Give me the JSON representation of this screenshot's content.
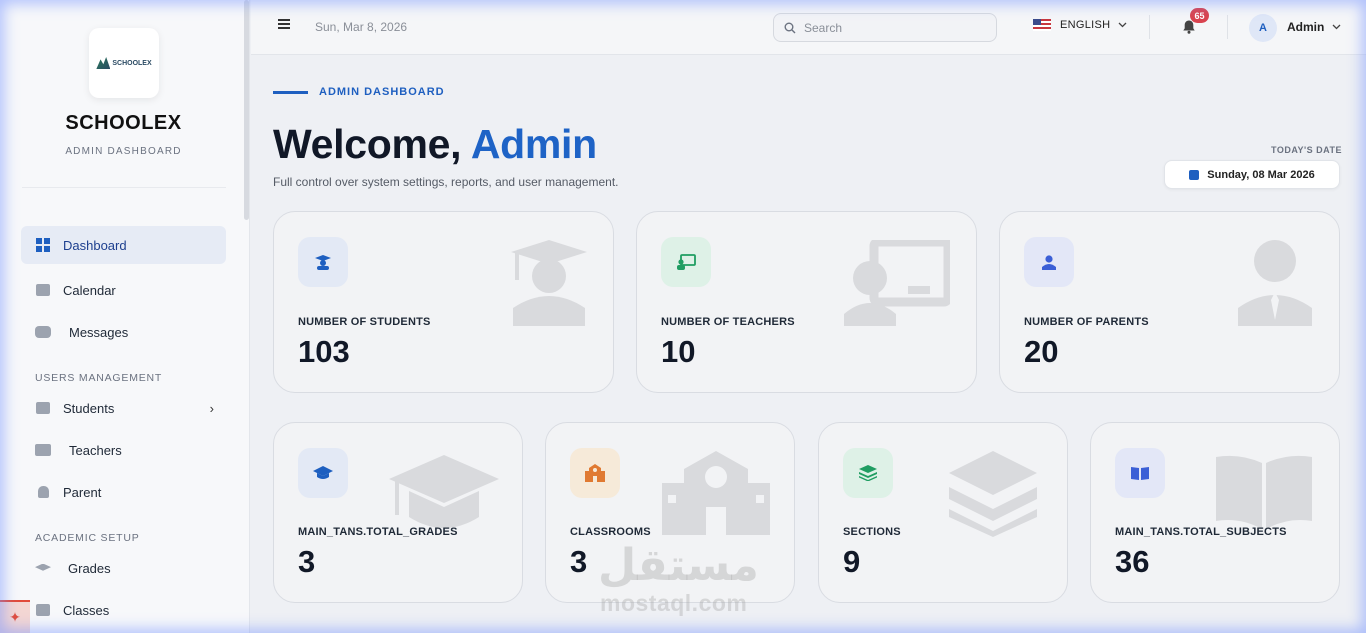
{
  "app": {
    "brand": "SCHOOLEX",
    "brand_subtitle": "ADMIN DASHBOARD",
    "logo_text": "SCHOOLEX"
  },
  "sidebar": {
    "items": [
      {
        "label": "Dashboard",
        "icon": "dashboard-grid-icon",
        "active": true
      },
      {
        "label": "Calendar",
        "icon": "calendar-icon"
      },
      {
        "label": "Messages",
        "icon": "messages-icon"
      }
    ],
    "sections": [
      {
        "title": "USERS MANAGEMENT",
        "items": [
          {
            "label": "Students",
            "icon": "students-icon",
            "chevron": "›"
          },
          {
            "label": "Teachers",
            "icon": "teachers-icon"
          },
          {
            "label": "Parent",
            "icon": "parent-icon"
          }
        ]
      },
      {
        "title": "ACADEMIC SETUP",
        "items": [
          {
            "label": "Grades",
            "icon": "graduation-cap-icon"
          },
          {
            "label": "Classes",
            "icon": "classes-icon"
          }
        ]
      }
    ]
  },
  "topbar": {
    "date": "Sun, Mar 8, 2026",
    "search_placeholder": "Search",
    "language": "ENGLISH",
    "notification_count": "65",
    "avatar_initial": "A",
    "user_name": "Admin"
  },
  "header": {
    "kicker": "ADMIN DASHBOARD",
    "welcome_prefix": "Welcome,",
    "welcome_name": "Admin",
    "subtitle": "Full control over system settings, reports, and user management.",
    "today_label": "TODAY'S DATE",
    "today_value": "Sunday, 08 Mar 2026"
  },
  "stats_row1": [
    {
      "label": "NUMBER OF STUDENTS",
      "value": "103",
      "icon": "student-icon",
      "accent": "#1e5fc0"
    },
    {
      "label": "NUMBER OF TEACHERS",
      "value": "10",
      "icon": "teacher-board-icon",
      "accent": "#1f9d62"
    },
    {
      "label": "NUMBER OF PARENTS",
      "value": "20",
      "icon": "parent-icon",
      "accent": "#3b5fd6"
    }
  ],
  "stats_row2": [
    {
      "label": "MAIN_TANS.TOTAL_GRADES",
      "value": "3",
      "icon": "graduation-cap-icon",
      "accent": "#1e5fc0"
    },
    {
      "label": "CLASSROOMS",
      "value": "3",
      "icon": "school-building-icon",
      "accent": "#e07a32"
    },
    {
      "label": "SECTIONS",
      "value": "9",
      "icon": "layers-icon",
      "accent": "#1f9d62"
    },
    {
      "label": "MAIN_TANS.TOTAL_SUBJECTS",
      "value": "36",
      "icon": "book-icon",
      "accent": "#3b5fd6"
    }
  ],
  "watermark": {
    "arabic": "مستقل",
    "latin": "mostaql.com"
  }
}
